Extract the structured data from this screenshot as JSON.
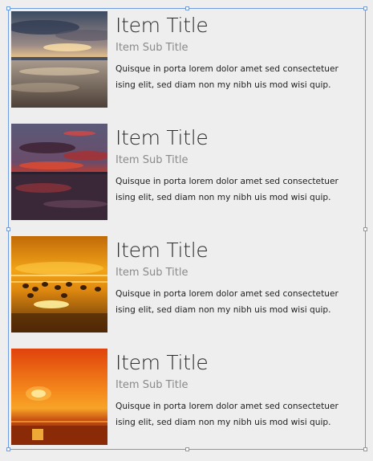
{
  "items": [
    {
      "image": "sunset-beach-clouds",
      "title": "Item Title",
      "subtitle": "Item Sub Title",
      "description": "Quisque in porta lorem dolor amet sed consectetuer ising elit, sed diam non my nibh uis mod wisi quip."
    },
    {
      "image": "dusk-red-sky-shore",
      "title": "Item Title",
      "subtitle": "Item Sub Title",
      "description": "Quisque in porta lorem dolor amet sed consectetuer ising elit, sed diam non my nibh uis mod wisi quip."
    },
    {
      "image": "golden-sunset-birds",
      "title": "Item Title",
      "subtitle": "Item Sub Title",
      "description": "Quisque in porta lorem dolor amet sed consectetuer ising elit, sed diam non my nibh uis mod wisi quip."
    },
    {
      "image": "orange-sun-horizon",
      "title": "Item Title",
      "subtitle": "Item Sub Title",
      "description": "Quisque in porta lorem dolor amet sed consectetuer ising elit, sed diam non my nibh uis mod wisi quip."
    }
  ],
  "colors": {
    "background": "#eeeeee",
    "selection": "#6f9be0",
    "title": "#2b2b2b",
    "subtitle": "#8a8a8a",
    "body": "#1e1e1e"
  }
}
